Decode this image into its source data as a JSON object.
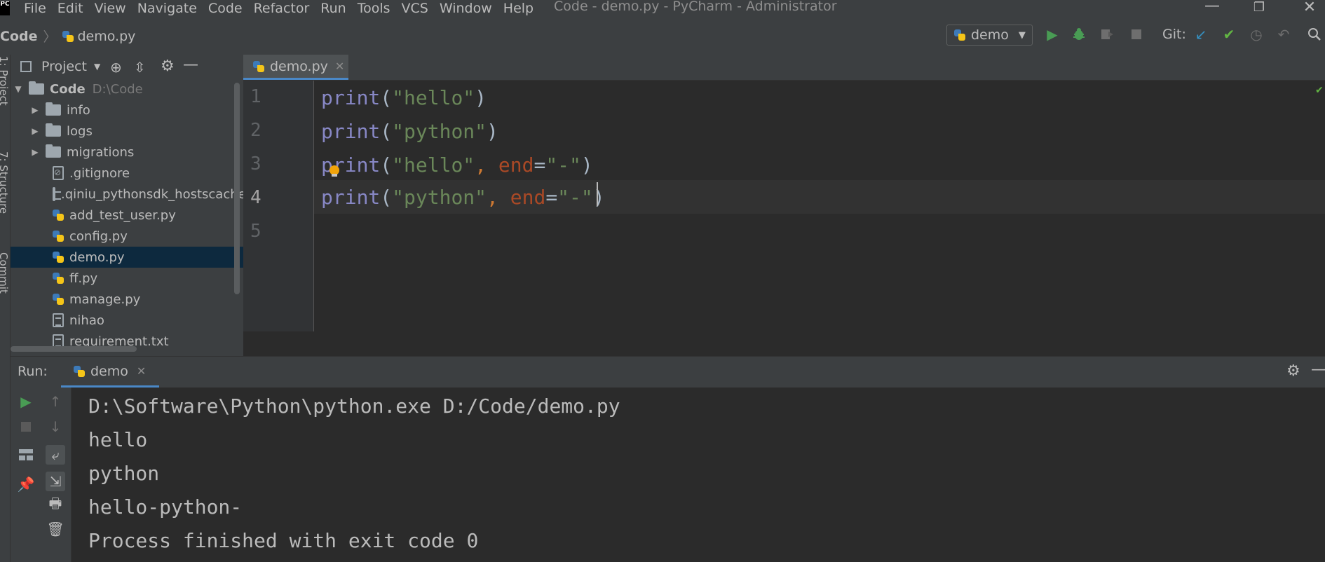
{
  "window": {
    "title": "Code - demo.py - PyCharm - Administrator",
    "logo_text": "PC",
    "minimize_glyph": "—",
    "maximize_glyph": "❐",
    "close_glyph": "✕"
  },
  "menu": [
    {
      "label": "File"
    },
    {
      "label": "Edit"
    },
    {
      "label": "View"
    },
    {
      "label": "Navigate"
    },
    {
      "label": "Code"
    },
    {
      "label": "Refactor"
    },
    {
      "label": "Run"
    },
    {
      "label": "Tools"
    },
    {
      "label": "VCS"
    },
    {
      "label": "Window"
    },
    {
      "label": "Help"
    }
  ],
  "breadcrumb": {
    "root": "Code",
    "separator": "〉",
    "file": "demo.py"
  },
  "toolbar": {
    "run_config": "demo",
    "git_label": "Git:",
    "icons": [
      "run-icon",
      "debug-icon",
      "coverage-icon",
      "stop-icon",
      "git-update-icon",
      "git-commit-icon",
      "git-history-icon",
      "git-rollback-icon",
      "search-icon"
    ]
  },
  "left_strip": {
    "tabs": [
      "1: Project",
      "7: Structure",
      "Commit"
    ]
  },
  "project": {
    "title": "Project",
    "root": {
      "name": "Code",
      "path": "D:\\Code"
    },
    "items": [
      {
        "name": "info",
        "type": "folder"
      },
      {
        "name": "logs",
        "type": "folder"
      },
      {
        "name": "migrations",
        "type": "folder"
      },
      {
        "name": ".gitignore",
        "type": "git"
      },
      {
        "name": ".qiniu_pythonsdk_hostscache.json",
        "type": "txt"
      },
      {
        "name": "add_test_user.py",
        "type": "py"
      },
      {
        "name": "config.py",
        "type": "py"
      },
      {
        "name": "demo.py",
        "type": "py",
        "selected": true
      },
      {
        "name": "ff.py",
        "type": "py"
      },
      {
        "name": "manage.py",
        "type": "py"
      },
      {
        "name": "nihao",
        "type": "txt"
      },
      {
        "name": "requirement.txt",
        "type": "txt"
      }
    ]
  },
  "editor": {
    "tab": "demo.py",
    "line_numbers": [
      "1",
      "2",
      "3",
      "4",
      "5"
    ],
    "lines": [
      [
        {
          "t": "print",
          "c": "kw-fn"
        },
        {
          "t": "(",
          "c": "par"
        },
        {
          "t": "\"hello\"",
          "c": "str"
        },
        {
          "t": ")",
          "c": "par"
        }
      ],
      [
        {
          "t": "print",
          "c": "kw-fn"
        },
        {
          "t": "(",
          "c": "par"
        },
        {
          "t": "\"python\"",
          "c": "str"
        },
        {
          "t": ")",
          "c": "par"
        }
      ],
      [
        {
          "t": "print",
          "c": "kw-fn"
        },
        {
          "t": "(",
          "c": "par"
        },
        {
          "t": "\"hello\"",
          "c": "str"
        },
        {
          "t": ", ",
          "c": "comma"
        },
        {
          "t": "end",
          "c": "kwarg"
        },
        {
          "t": "=",
          "c": "par"
        },
        {
          "t": "\"-\"",
          "c": "str"
        },
        {
          "t": ")",
          "c": "par"
        }
      ],
      [
        {
          "t": "print",
          "c": "kw-fn"
        },
        {
          "t": "(",
          "c": "par"
        },
        {
          "t": "\"python\"",
          "c": "str"
        },
        {
          "t": ", ",
          "c": "comma"
        },
        {
          "t": "end",
          "c": "kwarg"
        },
        {
          "t": "=",
          "c": "par"
        },
        {
          "t": "\"-\"",
          "c": "str"
        },
        {
          "t": ")",
          "c": "par"
        }
      ],
      []
    ]
  },
  "run": {
    "label": "Run:",
    "tab": "demo",
    "output": [
      "D:\\Software\\Python\\python.exe D:/Code/demo.py",
      "hello",
      "python",
      "hello-python-",
      "Process finished with exit code 0"
    ]
  },
  "colors": {
    "accent": "#4a88c7",
    "run_green": "#499c54",
    "checkmark": "#62b543",
    "git_blue": "#3592c4"
  }
}
